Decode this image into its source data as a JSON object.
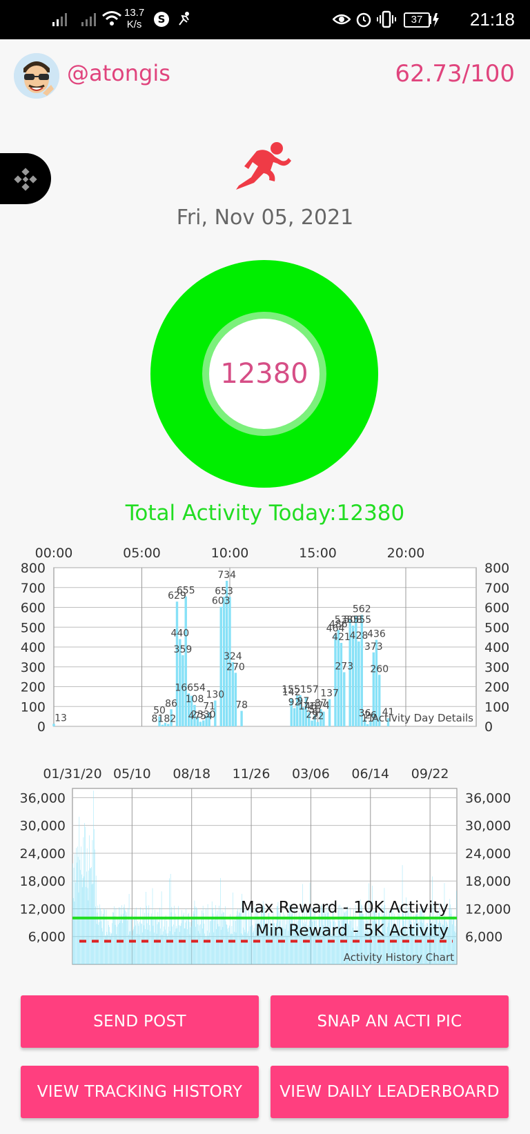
{
  "status_bar": {
    "net_speed_value": "13.7",
    "net_speed_unit": "K/s",
    "battery": "37",
    "time": "21:18"
  },
  "profile": {
    "username": "@atongis",
    "score": "62.73/100"
  },
  "icons": {
    "side_tab": "binance-logo-icon",
    "activity": "runner-icon"
  },
  "date": "Fri, Nov 05, 2021",
  "ring": {
    "value": "12380",
    "progress_fraction": 1.0,
    "color": "#00ee00"
  },
  "total_label": "Total Activity Today:12380",
  "chart_data": [
    {
      "type": "bar",
      "name": "Activity Day Details",
      "x_unit": "hour",
      "x_ticks": [
        "00:00",
        "05:00",
        "10:00",
        "15:00",
        "20:00"
      ],
      "x_tick_hours": [
        0,
        5,
        10,
        15,
        20
      ],
      "xlim": [
        0,
        24
      ],
      "ylim": [
        0,
        800
      ],
      "y_ticks": [
        0,
        100,
        200,
        300,
        400,
        500,
        600,
        700,
        800
      ],
      "bar_color": "#87e1f7",
      "bars": [
        {
          "x": 0.0,
          "y": 13
        },
        {
          "x": 6.0,
          "y": 50
        },
        {
          "x": 6.17,
          "y": 8
        },
        {
          "x": 6.33,
          "y": 18
        },
        {
          "x": 6.5,
          "y": 12
        },
        {
          "x": 6.67,
          "y": 86
        },
        {
          "x": 7.0,
          "y": 629
        },
        {
          "x": 7.17,
          "y": 440
        },
        {
          "x": 7.33,
          "y": 359
        },
        {
          "x": 7.5,
          "y": 655
        },
        {
          "x": 7.67,
          "y": 166
        },
        {
          "x": 7.83,
          "y": 154
        },
        {
          "x": 8.0,
          "y": 108
        },
        {
          "x": 8.17,
          "y": 47
        },
        {
          "x": 8.33,
          "y": 23
        },
        {
          "x": 8.5,
          "y": 30
        },
        {
          "x": 8.67,
          "y": 54
        },
        {
          "x": 8.83,
          "y": 71
        },
        {
          "x": 9.17,
          "y": 130
        },
        {
          "x": 9.5,
          "y": 603
        },
        {
          "x": 9.67,
          "y": 653
        },
        {
          "x": 9.83,
          "y": 734
        },
        {
          "x": 10.0,
          "y": 653
        },
        {
          "x": 10.17,
          "y": 324
        },
        {
          "x": 10.33,
          "y": 270
        },
        {
          "x": 10.67,
          "y": 78
        },
        {
          "x": 13.5,
          "y": 142
        },
        {
          "x": 13.67,
          "y": 92
        },
        {
          "x": 13.83,
          "y": 155
        },
        {
          "x": 14.0,
          "y": 157
        },
        {
          "x": 14.17,
          "y": 97
        },
        {
          "x": 14.33,
          "y": 146
        },
        {
          "x": 14.5,
          "y": 71
        },
        {
          "x": 14.67,
          "y": 29
        },
        {
          "x": 14.83,
          "y": 56
        },
        {
          "x": 15.0,
          "y": 22
        },
        {
          "x": 15.17,
          "y": 87
        },
        {
          "x": 15.33,
          "y": 74
        },
        {
          "x": 15.67,
          "y": 137
        },
        {
          "x": 16.0,
          "y": 464
        },
        {
          "x": 16.17,
          "y": 486
        },
        {
          "x": 16.33,
          "y": 421
        },
        {
          "x": 16.5,
          "y": 273
        },
        {
          "x": 16.83,
          "y": 538
        },
        {
          "x": 17.0,
          "y": 508
        },
        {
          "x": 17.17,
          "y": 555
        },
        {
          "x": 17.33,
          "y": 428
        },
        {
          "x": 17.5,
          "y": 562
        },
        {
          "x": 17.67,
          "y": 36
        },
        {
          "x": 17.83,
          "y": 11
        },
        {
          "x": 18.0,
          "y": 26
        },
        {
          "x": 18.17,
          "y": 373
        },
        {
          "x": 18.33,
          "y": 436
        },
        {
          "x": 18.5,
          "y": 260
        },
        {
          "x": 19.0,
          "y": 41
        }
      ],
      "labels": [
        {
          "x": 0.0,
          "text": "13"
        },
        {
          "x": 6.0,
          "text": "50"
        },
        {
          "x": 6.25,
          "text": "8182"
        },
        {
          "x": 6.67,
          "text": "86"
        },
        {
          "x": 7.0,
          "text": "629"
        },
        {
          "x": 7.17,
          "text": "440"
        },
        {
          "x": 7.33,
          "text": "359"
        },
        {
          "x": 7.5,
          "text": "655"
        },
        {
          "x": 7.75,
          "text": "16654"
        },
        {
          "x": 8.0,
          "text": "108"
        },
        {
          "x": 8.33,
          "text": "4754"
        },
        {
          "x": 8.5,
          "text": "2330"
        },
        {
          "x": 8.83,
          "text": "71"
        },
        {
          "x": 9.17,
          "text": "130"
        },
        {
          "x": 9.5,
          "text": "603"
        },
        {
          "x": 9.67,
          "text": "653"
        },
        {
          "x": 9.83,
          "text": "734"
        },
        {
          "x": 10.17,
          "text": "324"
        },
        {
          "x": 10.33,
          "text": "270"
        },
        {
          "x": 10.67,
          "text": "78"
        },
        {
          "x": 13.5,
          "text": "142"
        },
        {
          "x": 13.67,
          "text": "92"
        },
        {
          "x": 14.0,
          "text": "155157"
        },
        {
          "x": 14.17,
          "text": "97"
        },
        {
          "x": 14.42,
          "text": "146"
        },
        {
          "x": 14.5,
          "text": "71"
        },
        {
          "x": 14.67,
          "text": "29"
        },
        {
          "x": 14.83,
          "text": "56"
        },
        {
          "x": 15.0,
          "text": "22"
        },
        {
          "x": 15.17,
          "text": "87"
        },
        {
          "x": 15.33,
          "text": "74"
        },
        {
          "x": 15.67,
          "text": "137"
        },
        {
          "x": 16.0,
          "text": "464"
        },
        {
          "x": 16.17,
          "text": "486"
        },
        {
          "x": 16.33,
          "text": "421"
        },
        {
          "x": 16.5,
          "text": "273"
        },
        {
          "x": 17.0,
          "text": "538555"
        },
        {
          "x": 17.0,
          "text": "508"
        },
        {
          "x": 17.33,
          "text": "428"
        },
        {
          "x": 17.5,
          "text": "562"
        },
        {
          "x": 17.67,
          "text": "36"
        },
        {
          "x": 17.83,
          "text": "11"
        },
        {
          "x": 18.0,
          "text": "26"
        },
        {
          "x": 18.17,
          "text": "373"
        },
        {
          "x": 18.33,
          "text": "436"
        },
        {
          "x": 18.5,
          "text": "260"
        },
        {
          "x": 19.0,
          "text": "41"
        }
      ],
      "corner_label": "Activity Day Details",
      "grid": true
    },
    {
      "type": "bar",
      "name": "Activity History Chart",
      "x_ticks": [
        "01/31/20",
        "05/10",
        "08/18",
        "11/26",
        "03/06",
        "06/14",
        "09/22"
      ],
      "ylim": [
        0,
        36000
      ],
      "y_ticks": [
        "6,000",
        "12,000",
        "18,000",
        "24,000",
        "30,000",
        "36,000"
      ],
      "y_tick_values": [
        6000,
        12000,
        18000,
        24000,
        30000,
        36000
      ],
      "bar_color": "#87e1f7",
      "max_reward_value": 10000,
      "max_reward_label": "Max Reward - 10K Activity",
      "max_reward_color": "#22dd22",
      "min_reward_value": 5000,
      "min_reward_label": "Min Reward - 5K Activity",
      "min_reward_color": "#dd2222",
      "corner_label": "Activity History Chart",
      "grid": true
    }
  ],
  "buttons": {
    "send_post": "SEND POST",
    "snap_pic": "SNAP AN ACTI PIC",
    "tracking_history": "VIEW TRACKING HISTORY",
    "leaderboard": "VIEW DAILY LEADERBOARD"
  }
}
